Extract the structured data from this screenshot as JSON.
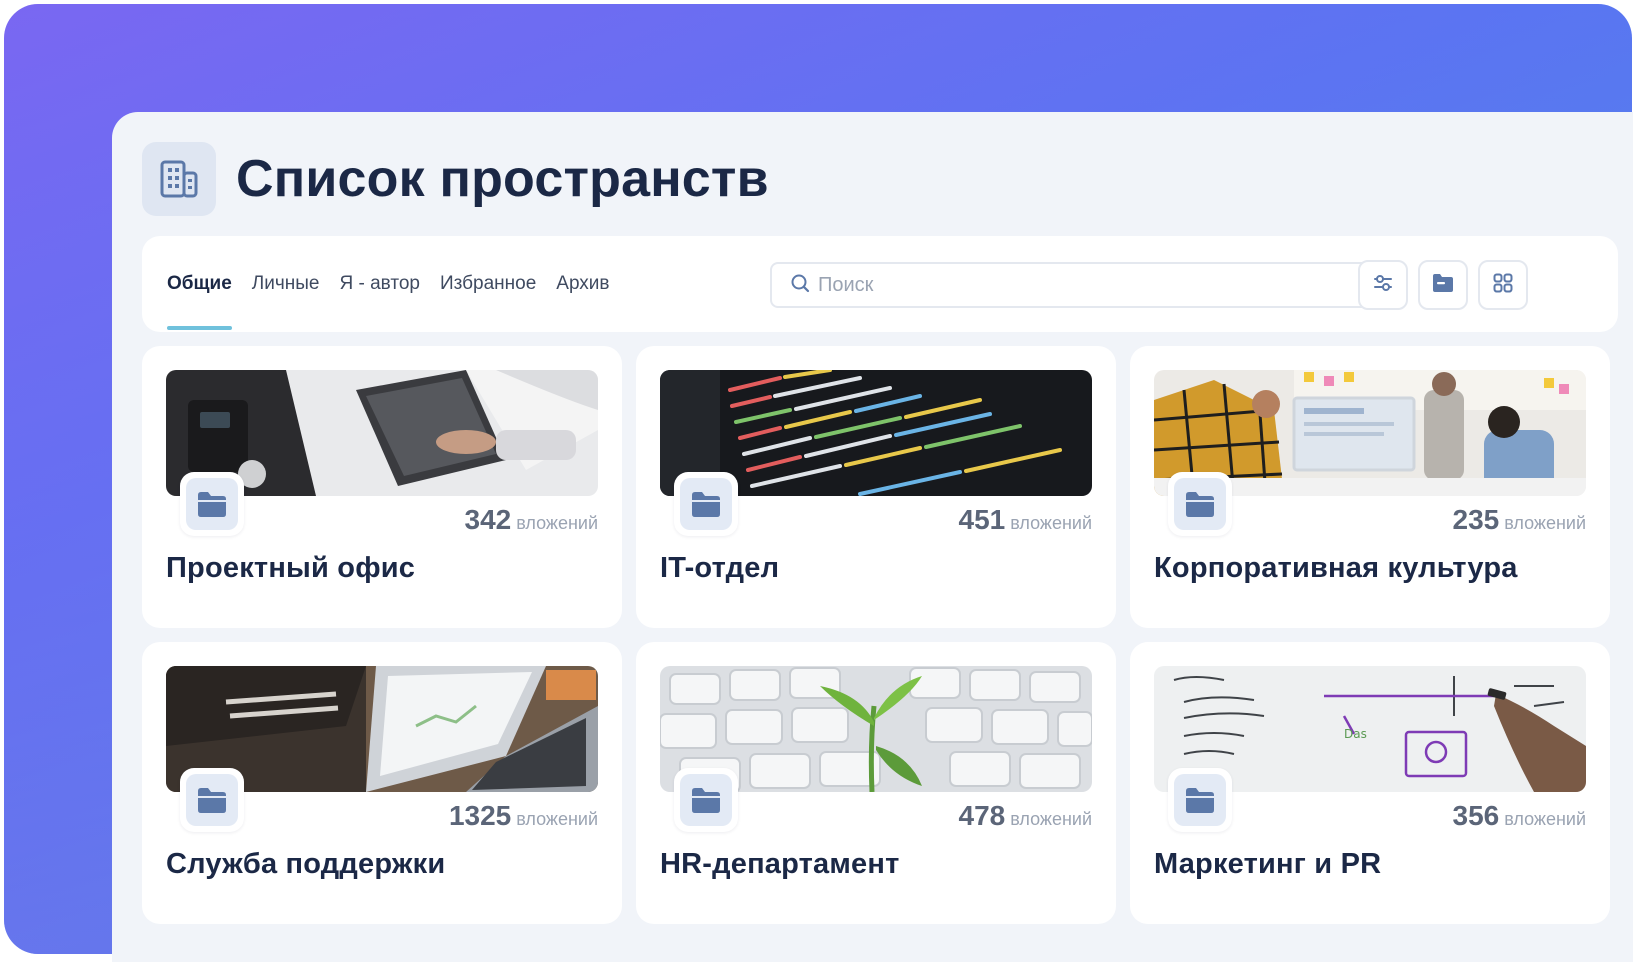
{
  "page": {
    "title": "Список пространств",
    "icon": "building-icon"
  },
  "tabs": [
    {
      "label": "Общие",
      "active": true
    },
    {
      "label": "Личные",
      "active": false
    },
    {
      "label": "Я - автор",
      "active": false
    },
    {
      "label": "Избранное",
      "active": false
    },
    {
      "label": "Архив",
      "active": false
    }
  ],
  "search": {
    "placeholder": "Поиск",
    "value": "",
    "icon": "search-icon"
  },
  "toolbar_buttons": [
    {
      "icon": "filter-icon"
    },
    {
      "icon": "folder-icon"
    },
    {
      "icon": "grid-view-icon"
    }
  ],
  "count_unit": "вложений",
  "spaces": [
    {
      "title": "Проектный офис",
      "count": "342",
      "image": "office-laptop-photo"
    },
    {
      "title": "IT-отдел",
      "count": "451",
      "image": "code-screen-photo"
    },
    {
      "title": "Корпоративная культура",
      "count": "235",
      "image": "team-meeting-photo"
    },
    {
      "title": "Служба поддержки",
      "count": "1325",
      "image": "laptop-desk-photo"
    },
    {
      "title": "HR-департамент",
      "count": "478",
      "image": "keyboard-plant-photo"
    },
    {
      "title": "Маркетинг и PR",
      "count": "356",
      "image": "whiteboard-photo"
    }
  ],
  "colors": {
    "accent": "#6fc1dc",
    "title": "#1b2846",
    "panel": "#f1f4f9",
    "icon": "#5b78a8"
  }
}
